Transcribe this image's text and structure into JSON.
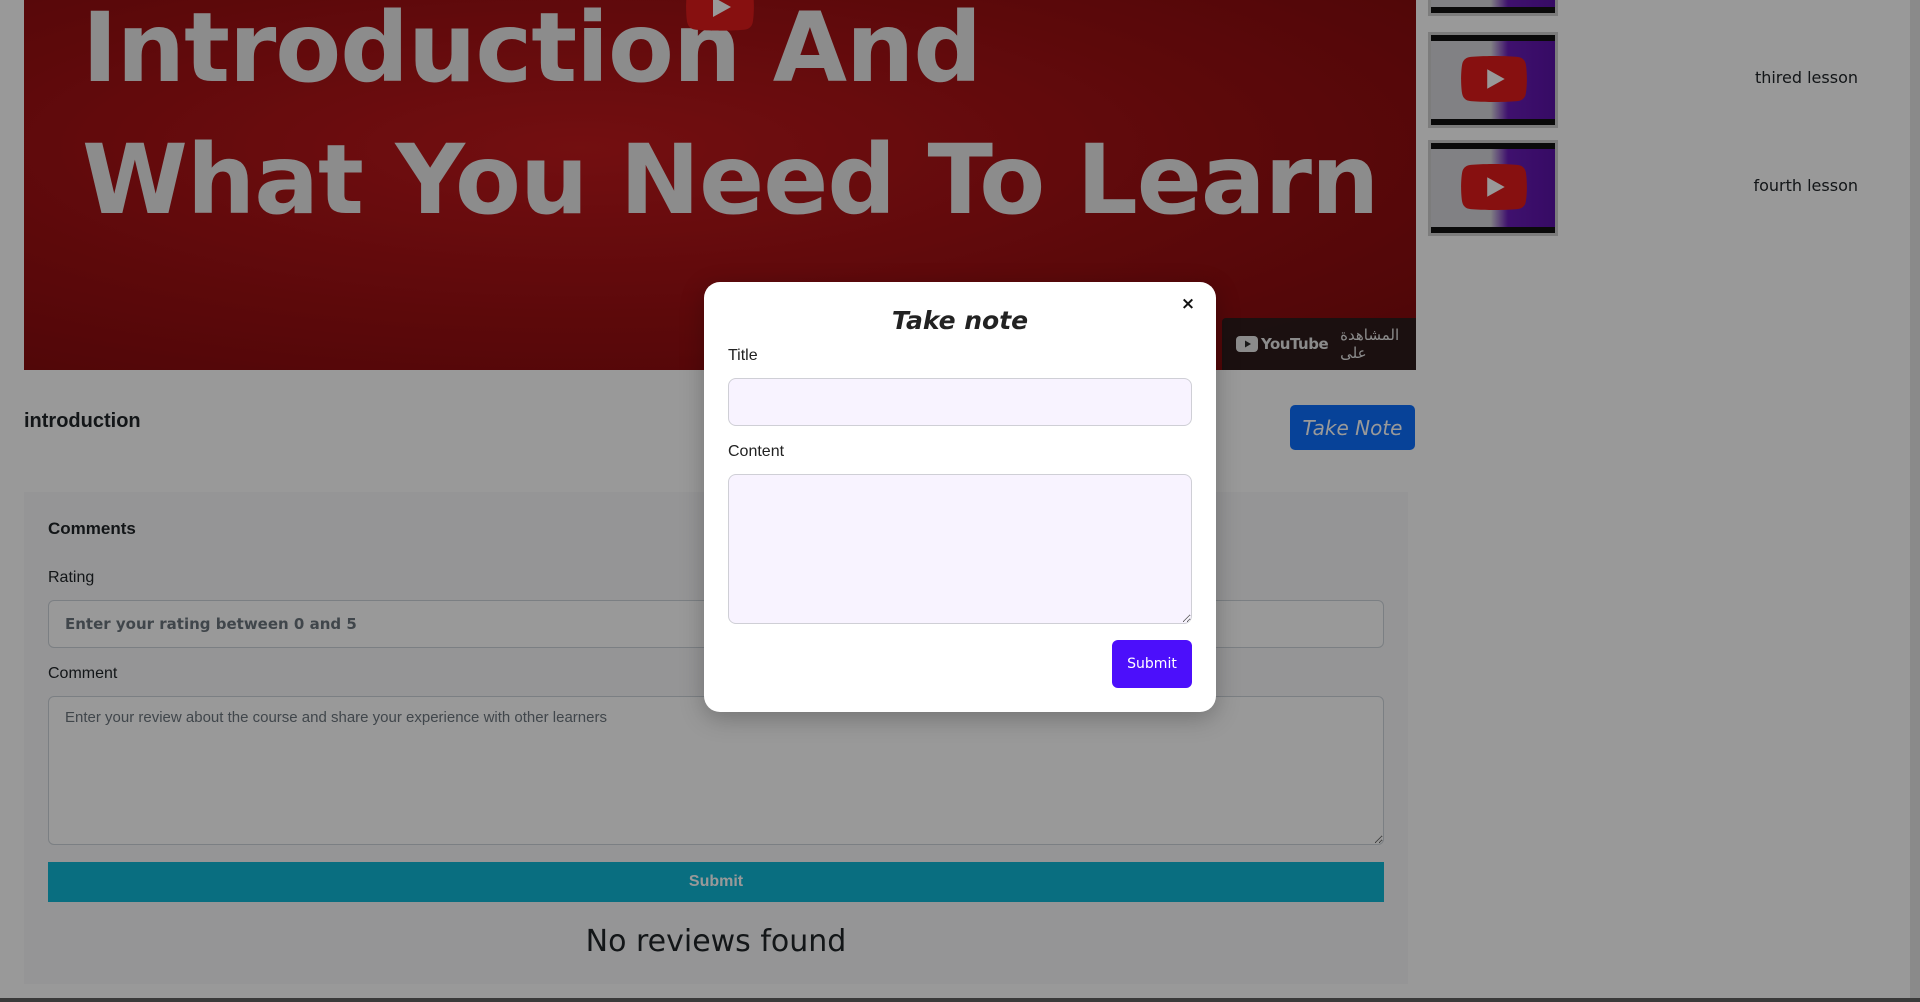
{
  "video": {
    "title_line1": "Introduction And",
    "title_line2": "What You Need To Learn",
    "youtube_badge_logo": "YouTube",
    "youtube_badge_text": "المشاهدة على",
    "play_icon": "youtube-play-icon"
  },
  "lesson": {
    "name": "introduction",
    "take_note_label": "Take Note"
  },
  "comments": {
    "heading": "Comments",
    "rating_label": "Rating",
    "rating_placeholder": "Enter your rating between 0 and 5",
    "comment_label": "Comment",
    "comment_placeholder": "Enter your review about the course and share your experience with other learners",
    "submit_label": "Submit",
    "empty_text": "No reviews found"
  },
  "playlist": {
    "items": [
      {
        "label": ""
      },
      {
        "label": "thired lesson"
      },
      {
        "label": "fourth lesson"
      }
    ]
  },
  "modal": {
    "title": "Take note",
    "close_label": "×",
    "title_label": "Title",
    "title_value": "",
    "content_label": "Content",
    "content_value": "",
    "submit_label": "Submit"
  },
  "colors": {
    "video_bg": "#9a0f12",
    "primary_blue": "#0d6efd",
    "teal_submit": "#0fb7d6",
    "modal_submit": "#4c0ffb",
    "modal_input_bg": "#f8f3ff"
  }
}
